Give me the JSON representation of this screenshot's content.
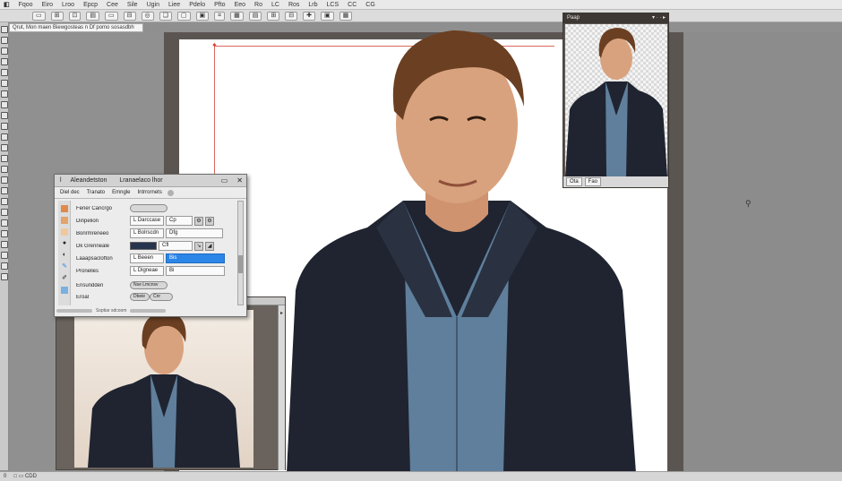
{
  "menubar": {
    "app": "◧",
    "items": [
      "Fqoo",
      "Eiro",
      "Lroo",
      "Epcp",
      "Cee",
      "Sile",
      "Ugin",
      "Liee",
      "Pdelo",
      "Pfto",
      "Eeo",
      "Ro",
      "LC",
      "Ros",
      "Lrb",
      "LCS",
      "CC",
      "CG"
    ]
  },
  "options_bar": {
    "items": [
      "▭",
      "⊞",
      "⊡",
      "▤",
      "▭",
      "⊟",
      "◎",
      "❏",
      "▢",
      "▣",
      "⌗",
      "▦",
      "▤",
      "⊞",
      "⊟",
      "✚",
      "▣",
      "▦"
    ]
  },
  "document_tab": "Qrut, Mon maen Biewgosteas n Df pomo sosasdbh",
  "navigator": {
    "title": "Paap",
    "controls": "▾ ·  ·  ▸",
    "footer": [
      "Ota",
      "Fao"
    ]
  },
  "dialog": {
    "title": "Ɩ",
    "title_text_1": "Aleandetston",
    "title_text_2": "Lranaelaco lhor",
    "controls": [
      "▭",
      "✕"
    ],
    "tabs": [
      "Diel dec",
      "Tranato",
      "Emngle",
      "Intrrornets"
    ],
    "rows": [
      {
        "label": "Fener  Cancrgo",
        "value": "",
        "extra": ""
      },
      {
        "label": "Dinpelion",
        "value": "L Darccase",
        "extra": "Cp"
      },
      {
        "label": "Bonrmreneeo",
        "value": "L Bolrscdn",
        "extra": "Dfg"
      },
      {
        "label": "Dk Grenneale",
        "value": "",
        "extra": "Cfl"
      },
      {
        "label": "Laaapsaclofton",
        "value": "L Beeen",
        "extra": "Bis"
      },
      {
        "label": "Pronelles",
        "value": "L Digneae",
        "extra": "Bi"
      },
      {
        "label": "Ensundden",
        "value": "Nse Lmcnsv",
        "extra": ""
      },
      {
        "label": "Eroal",
        "value": "Dbeie",
        "extra": "Cnr"
      }
    ],
    "bottom": "Ssptiar sdcoom"
  },
  "statusbar": [
    "0",
    "□ ▭ CDD"
  ],
  "cursor": "⚲",
  "colors": {
    "jacket": "#1f2430",
    "shirt": "#5f7f9c",
    "hair": "#6b3f22",
    "skin": "#d9a27e",
    "selection": "#2c86e8"
  }
}
